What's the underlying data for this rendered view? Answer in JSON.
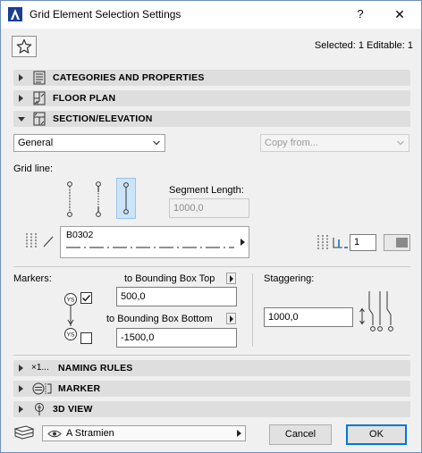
{
  "window": {
    "title": "Grid Element Selection Settings",
    "help_label": "?",
    "close_label": "✕"
  },
  "header": {
    "selected_info": "Selected: 1 Editable: 1"
  },
  "sections": {
    "categories": "CATEGORIES AND PROPERTIES",
    "floor_plan": "FLOOR PLAN",
    "section_elevation": "SECTION/ELEVATION",
    "naming_rules": "NAMING RULES",
    "naming_prefix": "×1...",
    "marker": "MARKER",
    "view_3d": "3D VIEW"
  },
  "section_panel": {
    "mode_select": "General",
    "copy_from_placeholder": "Copy from...",
    "grid_line_label": "Grid line:",
    "segment_length_label": "Segment Length:",
    "segment_length_value": "1000,0",
    "line_pattern_name": "B0302",
    "pen_number": "1",
    "markers_label": "Markers:",
    "to_bbox_top_label": "to Bounding Box Top",
    "to_bbox_top_value": "500,0",
    "to_bbox_bottom_label": "to Bounding Box Bottom",
    "to_bbox_bottom_value": "-1500,0",
    "staggering_label": "Staggering:",
    "staggering_value": "1000,0",
    "marker_top_checked": true,
    "marker_bottom_checked": false,
    "marker_symbol": "YS"
  },
  "footer": {
    "favorite_label": "A Stramien",
    "cancel_label": "Cancel",
    "ok_label": "OK"
  },
  "colors": {
    "accent": "#0078d7",
    "active_bg": "#cce4f7",
    "section_bg": "#dedede"
  }
}
